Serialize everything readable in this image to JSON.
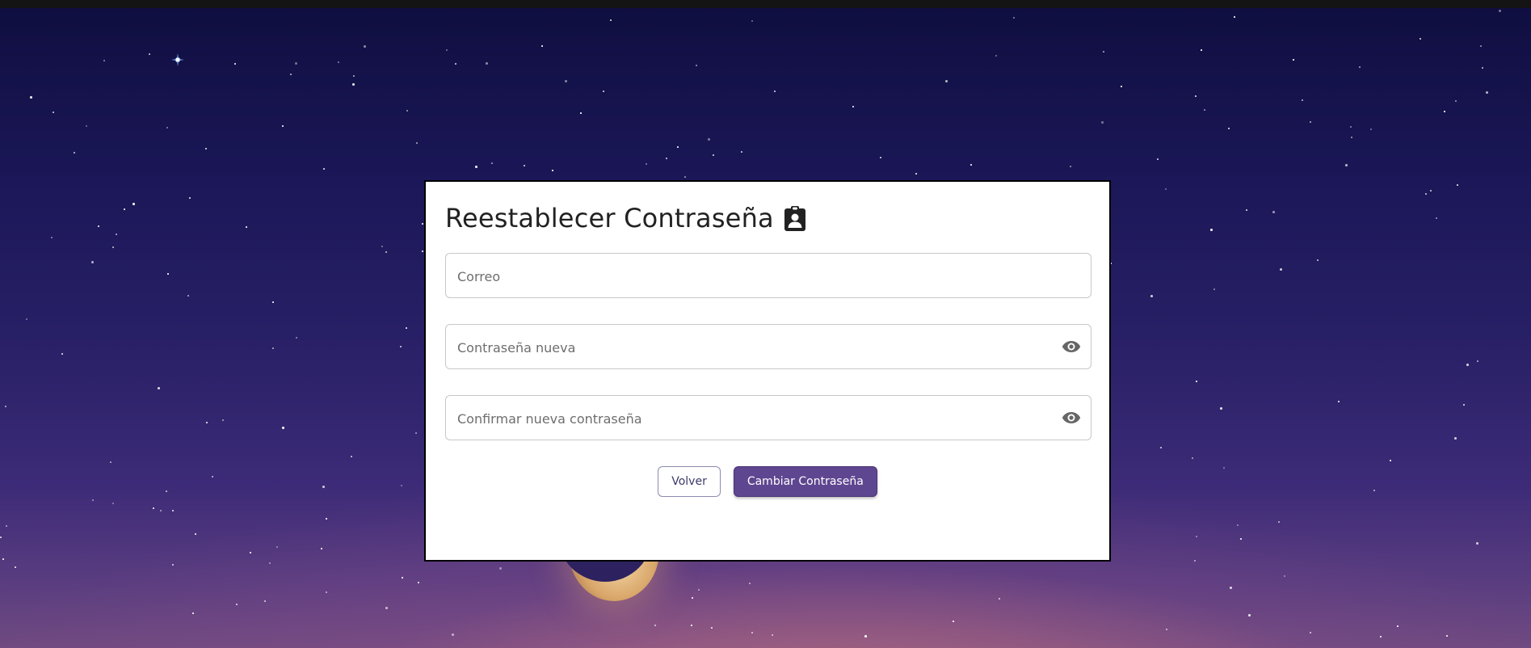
{
  "form": {
    "title": "Reestablecer Contraseña",
    "title_icon": "clipboard-user-icon",
    "fields": {
      "email": {
        "value": "",
        "placeholder": "Correo"
      },
      "new_password": {
        "value": "",
        "placeholder": "Contraseña nueva",
        "toggle_icon": "eye-icon"
      },
      "confirm_password": {
        "value": "",
        "placeholder": "Confirmar nueva contraseña",
        "toggle_icon": "eye-icon"
      }
    },
    "buttons": {
      "back_label": "Volver",
      "submit_label": "Cambiar Contraseña"
    }
  },
  "colors": {
    "primary": "#5f4690",
    "card_background": "#ffffff",
    "sky_top": "#0f0e3f",
    "sky_bottom": "#6f4a80"
  },
  "background": {
    "description_icons": [
      "stars",
      "crescent-moon"
    ]
  }
}
